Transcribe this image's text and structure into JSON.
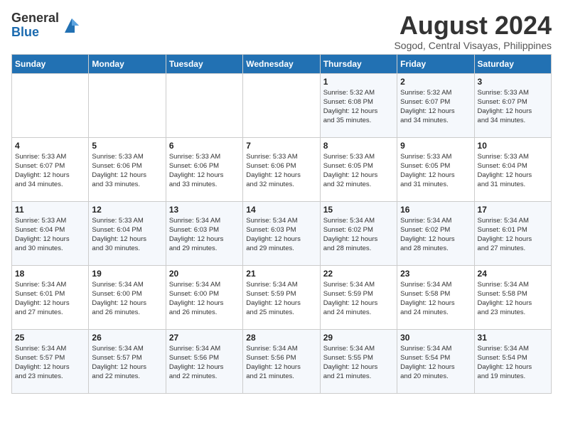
{
  "logo": {
    "general": "General",
    "blue": "Blue"
  },
  "title": {
    "month_year": "August 2024",
    "location": "Sogod, Central Visayas, Philippines"
  },
  "weekdays": [
    "Sunday",
    "Monday",
    "Tuesday",
    "Wednesday",
    "Thursday",
    "Friday",
    "Saturday"
  ],
  "weeks": [
    [
      {
        "day": "",
        "info": ""
      },
      {
        "day": "",
        "info": ""
      },
      {
        "day": "",
        "info": ""
      },
      {
        "day": "",
        "info": ""
      },
      {
        "day": "1",
        "info": "Sunrise: 5:32 AM\nSunset: 6:08 PM\nDaylight: 12 hours\nand 35 minutes."
      },
      {
        "day": "2",
        "info": "Sunrise: 5:32 AM\nSunset: 6:07 PM\nDaylight: 12 hours\nand 34 minutes."
      },
      {
        "day": "3",
        "info": "Sunrise: 5:33 AM\nSunset: 6:07 PM\nDaylight: 12 hours\nand 34 minutes."
      }
    ],
    [
      {
        "day": "4",
        "info": "Sunrise: 5:33 AM\nSunset: 6:07 PM\nDaylight: 12 hours\nand 34 minutes."
      },
      {
        "day": "5",
        "info": "Sunrise: 5:33 AM\nSunset: 6:06 PM\nDaylight: 12 hours\nand 33 minutes."
      },
      {
        "day": "6",
        "info": "Sunrise: 5:33 AM\nSunset: 6:06 PM\nDaylight: 12 hours\nand 33 minutes."
      },
      {
        "day": "7",
        "info": "Sunrise: 5:33 AM\nSunset: 6:06 PM\nDaylight: 12 hours\nand 32 minutes."
      },
      {
        "day": "8",
        "info": "Sunrise: 5:33 AM\nSunset: 6:05 PM\nDaylight: 12 hours\nand 32 minutes."
      },
      {
        "day": "9",
        "info": "Sunrise: 5:33 AM\nSunset: 6:05 PM\nDaylight: 12 hours\nand 31 minutes."
      },
      {
        "day": "10",
        "info": "Sunrise: 5:33 AM\nSunset: 6:04 PM\nDaylight: 12 hours\nand 31 minutes."
      }
    ],
    [
      {
        "day": "11",
        "info": "Sunrise: 5:33 AM\nSunset: 6:04 PM\nDaylight: 12 hours\nand 30 minutes."
      },
      {
        "day": "12",
        "info": "Sunrise: 5:33 AM\nSunset: 6:04 PM\nDaylight: 12 hours\nand 30 minutes."
      },
      {
        "day": "13",
        "info": "Sunrise: 5:34 AM\nSunset: 6:03 PM\nDaylight: 12 hours\nand 29 minutes."
      },
      {
        "day": "14",
        "info": "Sunrise: 5:34 AM\nSunset: 6:03 PM\nDaylight: 12 hours\nand 29 minutes."
      },
      {
        "day": "15",
        "info": "Sunrise: 5:34 AM\nSunset: 6:02 PM\nDaylight: 12 hours\nand 28 minutes."
      },
      {
        "day": "16",
        "info": "Sunrise: 5:34 AM\nSunset: 6:02 PM\nDaylight: 12 hours\nand 28 minutes."
      },
      {
        "day": "17",
        "info": "Sunrise: 5:34 AM\nSunset: 6:01 PM\nDaylight: 12 hours\nand 27 minutes."
      }
    ],
    [
      {
        "day": "18",
        "info": "Sunrise: 5:34 AM\nSunset: 6:01 PM\nDaylight: 12 hours\nand 27 minutes."
      },
      {
        "day": "19",
        "info": "Sunrise: 5:34 AM\nSunset: 6:00 PM\nDaylight: 12 hours\nand 26 minutes."
      },
      {
        "day": "20",
        "info": "Sunrise: 5:34 AM\nSunset: 6:00 PM\nDaylight: 12 hours\nand 26 minutes."
      },
      {
        "day": "21",
        "info": "Sunrise: 5:34 AM\nSunset: 5:59 PM\nDaylight: 12 hours\nand 25 minutes."
      },
      {
        "day": "22",
        "info": "Sunrise: 5:34 AM\nSunset: 5:59 PM\nDaylight: 12 hours\nand 24 minutes."
      },
      {
        "day": "23",
        "info": "Sunrise: 5:34 AM\nSunset: 5:58 PM\nDaylight: 12 hours\nand 24 minutes."
      },
      {
        "day": "24",
        "info": "Sunrise: 5:34 AM\nSunset: 5:58 PM\nDaylight: 12 hours\nand 23 minutes."
      }
    ],
    [
      {
        "day": "25",
        "info": "Sunrise: 5:34 AM\nSunset: 5:57 PM\nDaylight: 12 hours\nand 23 minutes."
      },
      {
        "day": "26",
        "info": "Sunrise: 5:34 AM\nSunset: 5:57 PM\nDaylight: 12 hours\nand 22 minutes."
      },
      {
        "day": "27",
        "info": "Sunrise: 5:34 AM\nSunset: 5:56 PM\nDaylight: 12 hours\nand 22 minutes."
      },
      {
        "day": "28",
        "info": "Sunrise: 5:34 AM\nSunset: 5:56 PM\nDaylight: 12 hours\nand 21 minutes."
      },
      {
        "day": "29",
        "info": "Sunrise: 5:34 AM\nSunset: 5:55 PM\nDaylight: 12 hours\nand 21 minutes."
      },
      {
        "day": "30",
        "info": "Sunrise: 5:34 AM\nSunset: 5:54 PM\nDaylight: 12 hours\nand 20 minutes."
      },
      {
        "day": "31",
        "info": "Sunrise: 5:34 AM\nSunset: 5:54 PM\nDaylight: 12 hours\nand 19 minutes."
      }
    ]
  ]
}
